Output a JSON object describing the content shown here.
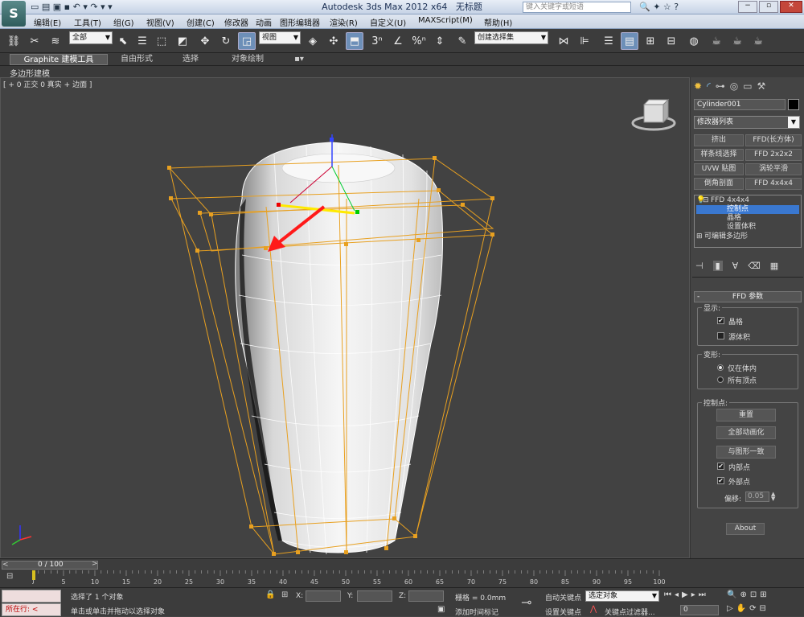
{
  "title": {
    "app": "Autodesk 3ds Max  2012 x64",
    "file": "无标题",
    "search_placeholder": "键入关键字或短语"
  },
  "menu": [
    "编辑(E)",
    "工具(T)",
    "组(G)",
    "视图(V)",
    "创建(C)",
    "修改器",
    "动画",
    "图形编辑器",
    "渲染(R)",
    "自定义(U)",
    "MAXScript(M)",
    "帮助(H)"
  ],
  "toolbar": {
    "select_filter": "全部",
    "ref_coord": "视图",
    "named_selection": "创建选择集"
  },
  "ribbon": {
    "tabs": [
      "Graphite 建模工具",
      "自由形式",
      "选择",
      "对象绘制"
    ],
    "sub_label": "多边形建模"
  },
  "viewport": {
    "label": "[ + 0 正交 0 真实 + 边面 ]"
  },
  "command_panel": {
    "object_name": "Cylinder001",
    "modifier_list": "修改器列表",
    "mod_buttons": [
      "挤出",
      "FFD(长方体)",
      "样条线选择",
      "FFD 2x2x2",
      "UVW 贴图",
      "涡轮平滑",
      "倒角剖面",
      "FFD 4x4x4"
    ],
    "stack": [
      {
        "label": "FFD 4x4x4",
        "level": 0,
        "selected": false
      },
      {
        "label": "控制点",
        "level": 1,
        "selected": true
      },
      {
        "label": "晶格",
        "level": 1,
        "selected": false
      },
      {
        "label": "设置体积",
        "level": 1,
        "selected": false
      },
      {
        "label": "可编辑多边形",
        "level": 0,
        "selected": false
      }
    ],
    "rollout_title": "FFD 参数",
    "display_group": "显示:",
    "lattice_label": "晶格",
    "lattice_checked": true,
    "source_volume_label": "源体积",
    "source_volume_checked": false,
    "deform_group": "变形:",
    "deform_in_volume": "仅在体内",
    "deform_all": "所有顶点",
    "cp_group": "控制点:",
    "reset_button": "重置",
    "animate_all_button": "全部动画化",
    "conform_button": "与图形一致",
    "inside_points": "内部点",
    "outside_points": "外部点",
    "offset_label": "偏移:",
    "offset_value": "0.05",
    "about_button": "About"
  },
  "timeline": {
    "frame": "0 / 100",
    "ticks": [
      "0",
      "5",
      "10",
      "15",
      "20",
      "25",
      "30",
      "35",
      "40",
      "45",
      "50",
      "55",
      "60",
      "65",
      "70",
      "75",
      "80",
      "85",
      "90",
      "95",
      "100"
    ]
  },
  "status": {
    "running": "所在行:",
    "selection": "选择了 1 个对象",
    "prompt": "单击或单击并拖动以选择对象",
    "x_label": "X:",
    "y_label": "Y:",
    "z_label": "Z:",
    "grid": "栅格 = 0.0mm",
    "add_time_tag": "添加时间标记",
    "auto_key": "自动关键点",
    "selected_dropdown": "选定对象",
    "set_key": "设置关键点",
    "key_filters": "关键点过滤器...",
    "frame_value": "0"
  },
  "colors": {
    "lattice": "#e8a020",
    "arrow": "#ff1a1a",
    "selected_stack": "#3a78d0"
  }
}
